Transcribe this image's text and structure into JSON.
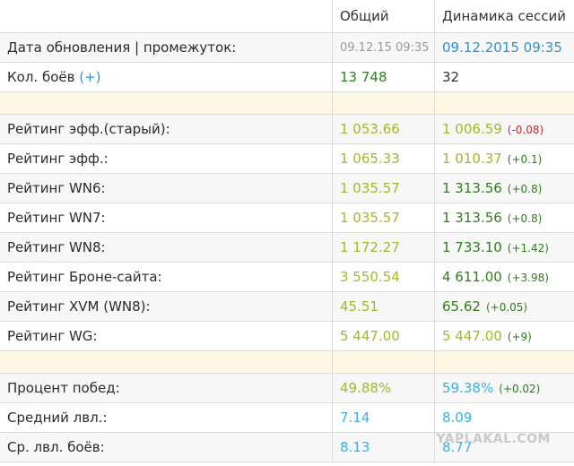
{
  "header": {
    "col_total": "Общий",
    "col_session": "Динамика сессий"
  },
  "rows": {
    "update": {
      "label": "Дата обновления | промежуток:",
      "total": "09.12.15 09:35",
      "session": "09.12.2015 09:35"
    },
    "battles": {
      "label": "Кол. боёв",
      "plus": "(+)",
      "total": "13 748",
      "session": "32"
    },
    "eff_old": {
      "label": "Рейтинг эфф.(старый):",
      "total": "1 053.66",
      "session": "1 006.59",
      "delta": "(-0.08)"
    },
    "eff": {
      "label": "Рейтинг эфф.:",
      "total": "1 065.33",
      "session": "1 010.37",
      "delta": "(+0.1)"
    },
    "wn6": {
      "label": "Рейтинг WN6:",
      "total": "1 035.57",
      "session": "1 313.56",
      "delta": "(+0.8)"
    },
    "wn7": {
      "label": "Рейтинг WN7:",
      "total": "1 035.57",
      "session": "1 313.56",
      "delta": "(+0.8)"
    },
    "wn8": {
      "label": "Рейтинг WN8:",
      "total": "1 172.27",
      "session": "1 733.10",
      "delta": "(+1.42)"
    },
    "brone": {
      "label": "Рейтинг Броне-сайта:",
      "total": "3 550.54",
      "session": "4 611.00",
      "delta": "(+3.98)"
    },
    "xvm": {
      "label": "Рейтинг XVM (WN8):",
      "total": "45.51",
      "session": "65.62",
      "delta": "(+0.05)"
    },
    "wg": {
      "label": "Рейтинг WG:",
      "total": "5 447.00",
      "session": "5 447.00",
      "delta": "(+9)"
    },
    "winrate": {
      "label": "Процент побед:",
      "total": "49.88%",
      "session": "59.38%",
      "delta": "(+0.02)"
    },
    "avg_lvl": {
      "label": "Средний лвл.:",
      "total": "7.14",
      "session": "8.09"
    },
    "avg_battle_lvl": {
      "label": "Ср. лвл. боёв:",
      "total": "8.13",
      "session": "8.77"
    }
  },
  "watermark": "YAPLAKAL.COM",
  "colors": {
    "rating_total": "#9bbb2a",
    "rating_good": "#2f7d1e",
    "rating_blue": "#2f8fd6",
    "rating_cyan": "#33b3e6",
    "separator": "#fdf6e3"
  }
}
